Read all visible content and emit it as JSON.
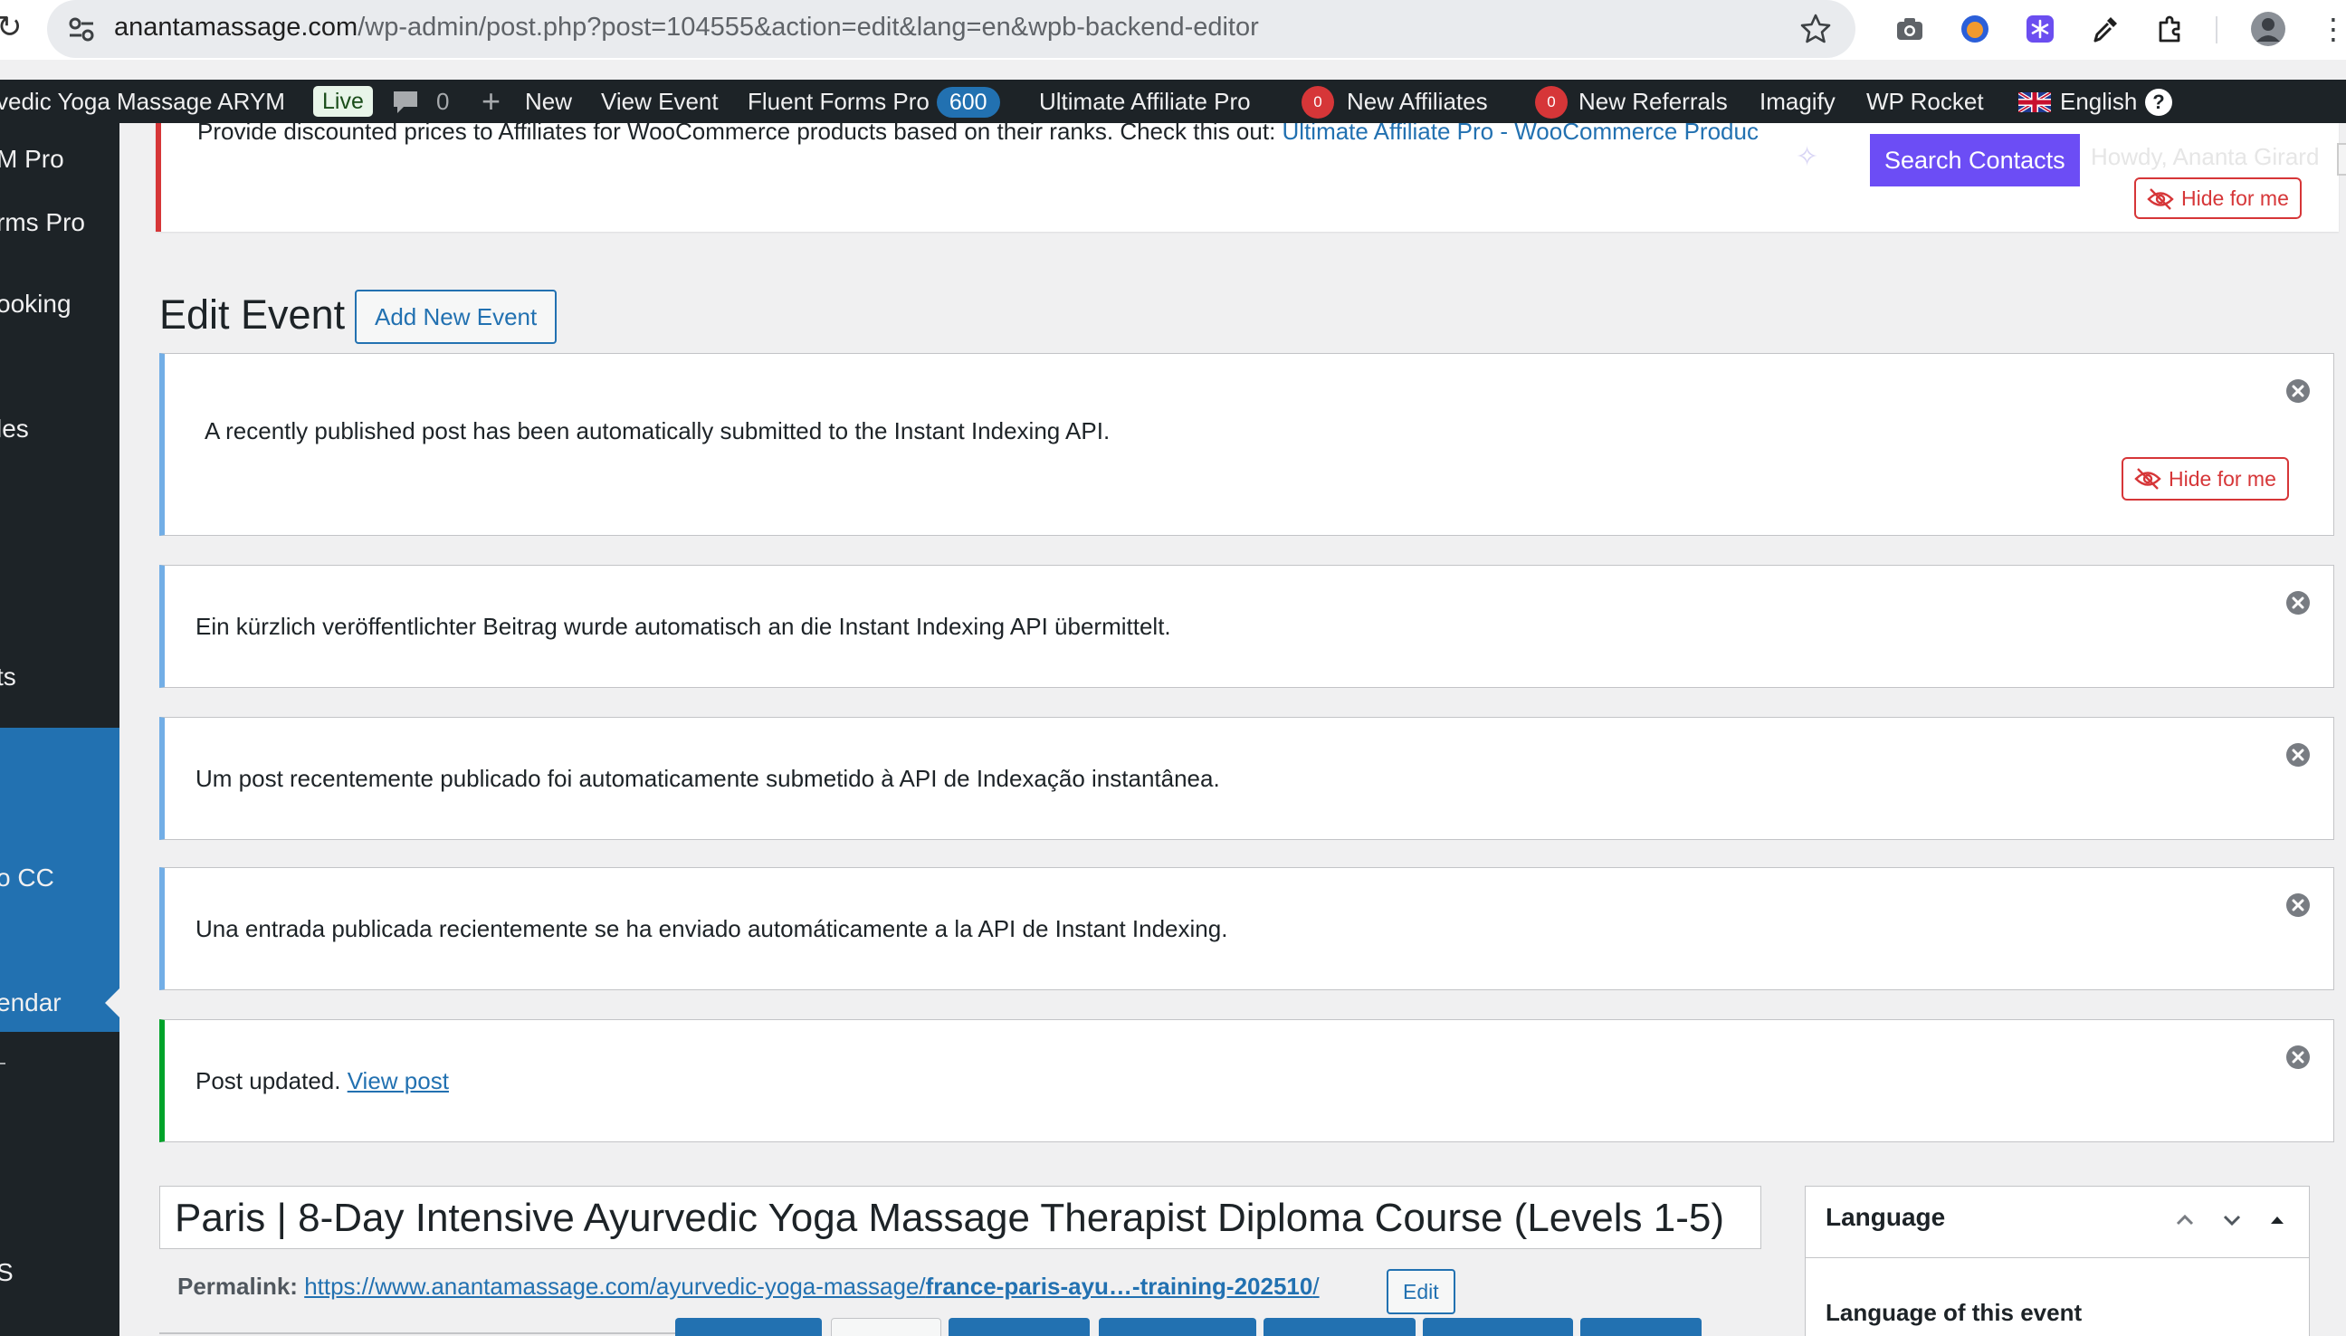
{
  "browser": {
    "url_host": "anantamassage.com",
    "url_path": "/wp-admin/post.php?post=104555&action=edit&lang=en&wpb-backend-editor"
  },
  "adminbar": {
    "site_name": "vedic Yoga Massage ARYM",
    "live_badge": "Live",
    "comments_count": "0",
    "new_label": "New",
    "view_event": "View Event",
    "fluent_forms": "Fluent Forms Pro",
    "fluent_count": "600",
    "ultimate_affiliate": "Ultimate Affiliate Pro",
    "new_affiliates_count": "0",
    "new_affiliates": "New Affiliates",
    "new_referrals_count": "0",
    "new_referrals": "New Referrals",
    "imagify": "Imagify",
    "wp_rocket": "WP Rocket",
    "language": "English",
    "help": "?"
  },
  "sidebar": {
    "items": [
      "M Pro",
      "rms Pro",
      "ooking",
      "les",
      "ts",
      "o CC",
      "endar",
      "S"
    ]
  },
  "top_notice": {
    "text": "Provide discounted prices to Affiliates for WooCommerce products based on their ranks. Check this out: ",
    "link": "Ultimate Affiliate Pro - WooCommerce Produc",
    "search_contacts": "Search Contacts",
    "howdy": "Howdy, Ananta Girard",
    "hide_label": "Hide for me"
  },
  "page": {
    "title": "Edit Event",
    "add_new": "Add New Event"
  },
  "notices": [
    {
      "text": "A recently published post has been automatically submitted to the Instant Indexing API.",
      "hide_label": "Hide for me"
    },
    {
      "text": "Ein kürzlich veröffentlichter Beitrag wurde automatisch an die Instant Indexing API übermittelt."
    },
    {
      "text": "Um post recentemente publicado foi automaticamente submetido à API de Indexação instantânea."
    },
    {
      "text": "Una entrada publicada recientemente se ha enviado automáticamente a la API de Instant Indexing."
    },
    {
      "text": "Post updated. ",
      "link": "View post"
    }
  ],
  "post": {
    "title": "Paris | 8-Day Intensive Ayurvedic Yoga Massage Therapist Diploma Course (Levels 1-5)",
    "permalink_label": "Permalink:",
    "permalink_base": "https://www.anantamassage.com/ayurvedic-yoga-massage/",
    "permalink_slug": "france-paris-ayu…-training-202510",
    "permalink_tail": "/",
    "edit_label": "Edit"
  },
  "language_box": {
    "title": "Language",
    "subtitle": "Language of this event"
  },
  "colors": {
    "accent": "#2271b1",
    "admin_bar": "#1d2327",
    "error": "#d63638",
    "success": "#00a32a",
    "info": "#72aee6",
    "purple": "#6c4df5"
  }
}
